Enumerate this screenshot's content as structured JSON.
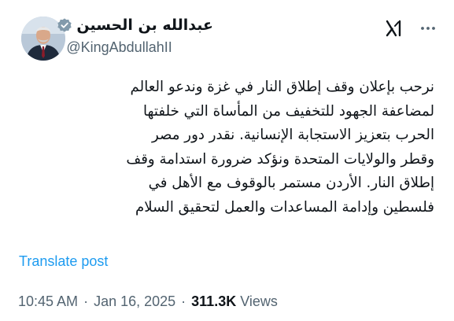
{
  "author": {
    "display_name": "عبدالله بن الحسين",
    "handle": "@KingAbdullahII",
    "avatar_icon": "profile-photo",
    "verified_icon": "verified-badge-icon",
    "verified_color": "#829aab"
  },
  "toolbar": {
    "grok_icon": "grok-icon",
    "more_icon": "more-options-icon"
  },
  "tweet": {
    "lines": [
      "نرحب بإعلان وقف إطلاق النار في غزة وندعو العالم",
      "لمضاعفة الجهود للتخفيف من المأساة التي خلفتها",
      "الحرب بتعزيز الاستجابة الإنسانية. نقدر دور مصر",
      "وقطر والولايات المتحدة ونؤكد ضرورة استدامة وقف",
      "إطلاق النار. الأردن مستمر بالوقوف مع الأهل في",
      "فلسطين وإدامة المساعدات والعمل لتحقيق السلام"
    ],
    "translate_label": "Translate post"
  },
  "meta": {
    "time": "10:45 AM",
    "separator": "·",
    "date": "Jan 16, 2025",
    "views_count": "311.3K",
    "views_label": "Views"
  },
  "colors": {
    "text": "#0f1419",
    "secondary": "#536471",
    "link": "#1d9bf0"
  }
}
